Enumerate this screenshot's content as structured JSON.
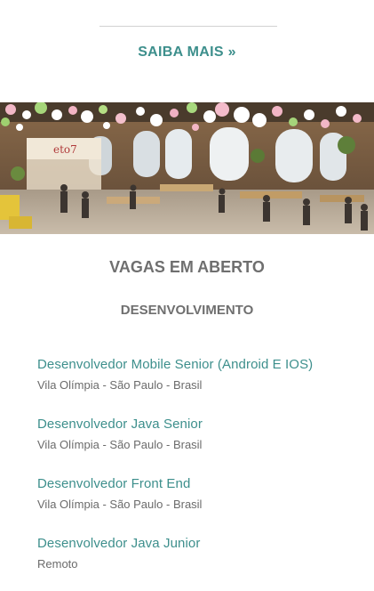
{
  "saiba_mais": "SAIBA MAIS »",
  "photo_sign": "eto7",
  "vagas": {
    "title": "VAGAS EM ABERTO",
    "category": "DESENVOLVIMENTO",
    "jobs": [
      {
        "title": "Desenvolvedor Mobile Senior (Android E IOS)",
        "location": "Vila Olímpia - São Paulo - Brasil"
      },
      {
        "title": "Desenvolvedor Java Senior",
        "location": "Vila Olímpia - São Paulo - Brasil"
      },
      {
        "title": "Desenvolvedor Front End",
        "location": "Vila Olímpia - São Paulo - Brasil"
      },
      {
        "title": "Desenvolvedor Java Junior",
        "location": "Remoto"
      }
    ]
  },
  "colors": {
    "accent": "#3d8f8c",
    "text": "#6b6b6b"
  }
}
